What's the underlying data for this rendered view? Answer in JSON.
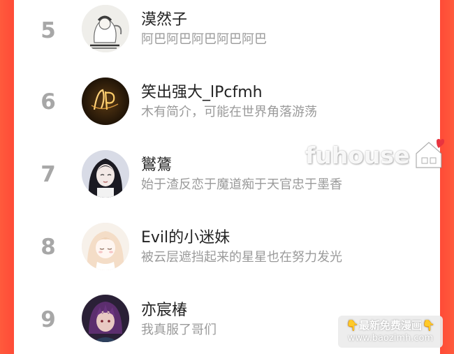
{
  "ranking": {
    "rows": [
      {
        "rank": "5",
        "name": "漠然子",
        "description": "阿巴阿巴阿巴阿巴阿巴",
        "avatar_icon": "manga-figure-avatar"
      },
      {
        "rank": "6",
        "name": "笑出强大_lPcfmh",
        "description": "木有简介，可能在世界角落游荡",
        "avatar_icon": "neon-sign-avatar"
      },
      {
        "rank": "7",
        "name": "鸑鷟",
        "description": "始于渣反恋于魔道痴于天官忠于墨香",
        "avatar_icon": "dark-hair-girl-avatar"
      },
      {
        "rank": "8",
        "name": "Evil的小迷妹",
        "description": "被云层遮挡起来的星星也在努力发光",
        "avatar_icon": "blonde-girl-avatar"
      },
      {
        "rank": "9",
        "name": "亦宸椿",
        "description": "我真服了哥们",
        "avatar_icon": "purple-hair-boy-avatar"
      }
    ]
  },
  "watermark": {
    "text": "fuhouse",
    "icon": "house-heart-icon"
  },
  "badge": {
    "title": "👇最新免费漫画👇",
    "url": "www.baozimh.com"
  },
  "colors": {
    "side_accent": "#ff4b37",
    "rank_gray": "#a7a7a7",
    "name_text": "#222222",
    "desc_text": "#9a9a9a",
    "heart": "#e8343f"
  }
}
